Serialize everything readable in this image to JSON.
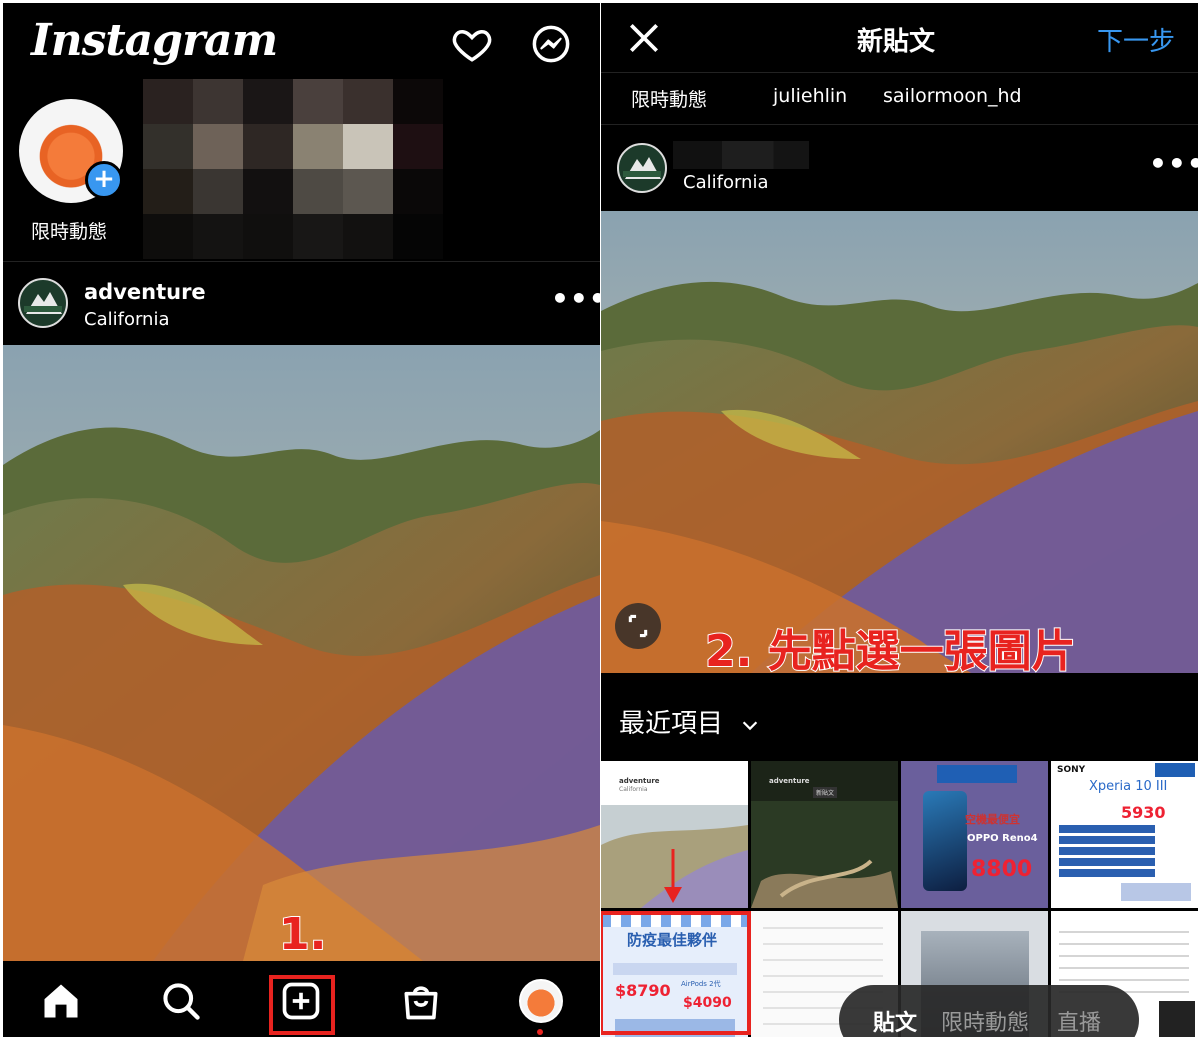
{
  "left": {
    "logo": "Instagram",
    "own_story_label": "限時動態",
    "post": {
      "username": "adventure",
      "location": "California",
      "more": "•••"
    },
    "tabs": [
      "home",
      "search",
      "create",
      "shop",
      "profile"
    ],
    "annotation": "1."
  },
  "right": {
    "header": {
      "title": "新貼文",
      "next": "下一步"
    },
    "stories": [
      "限時動態",
      "juliehlin",
      "sailormoon_hd"
    ],
    "post": {
      "location": "California",
      "more": "•••"
    },
    "annotation": "2. 先點選一張圖片",
    "album_label": "最近項目",
    "thumbnails": [
      {
        "brand": "",
        "line1": "adventure",
        "line2": "California"
      },
      {
        "brand": "",
        "line1": "adventure",
        "line2": "新貼文"
      },
      {
        "brand": "",
        "line1": "空機最便宜",
        "line2": "OPPO Reno4",
        "price": "8800"
      },
      {
        "brand": "SONY",
        "line1": "Xperia 10 III",
        "price": "5930"
      },
      {
        "brand": "",
        "line1": "防疫最佳夥伴",
        "price_a": "$8790",
        "price_b": "$4090",
        "sub": "AirPods 2代"
      }
    ],
    "modes": [
      "貼文",
      "限時動態",
      "直播"
    ]
  },
  "colors": {
    "accent_blue": "#3897f0",
    "annotation_red": "#e8231f",
    "bg": "#000000"
  }
}
